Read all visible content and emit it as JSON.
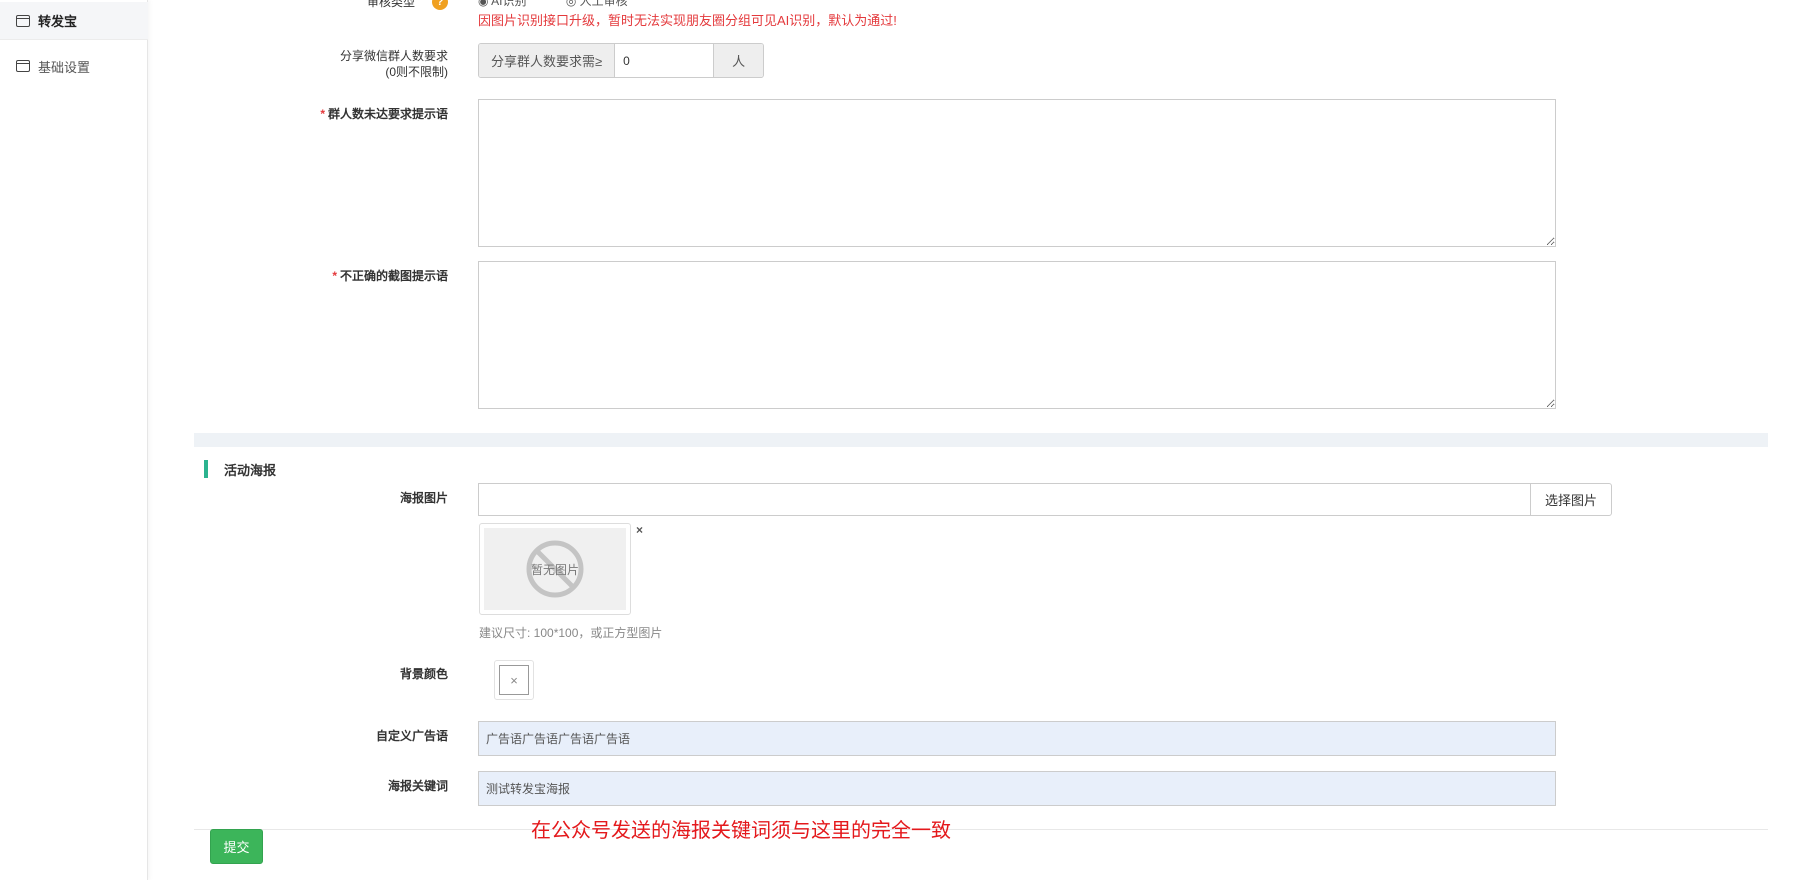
{
  "sidebar": {
    "items": [
      {
        "label": "转发宝",
        "icon": "window-icon"
      },
      {
        "label": "基础设置",
        "icon": "window-icon"
      }
    ]
  },
  "form": {
    "review_type": {
      "label": "审核类型",
      "help": "?",
      "options_text": "◉ AI识别　　　 ◎ 人工审核",
      "warning": "因图片识别接口升级，暂时无法实现朋友圈分组可见AI识别，默认为通过!"
    },
    "group_size": {
      "label_line1": "分享微信群人数要求",
      "label_line2": "(0则不限制)",
      "prefix": "分享群人数要求需≥",
      "value": "0",
      "suffix": "人"
    },
    "group_tip": {
      "required": "*",
      "label": "群人数未达要求提示语",
      "value": ""
    },
    "screenshot_tip": {
      "required": "*",
      "label": "不正确的截图提示语",
      "value": ""
    }
  },
  "poster": {
    "section_title": "活动海报",
    "image_label": "海报图片",
    "image_value": "",
    "pick_button": "选择图片",
    "no_image_text": "暂无图片",
    "remove_glyph": "×",
    "hint": "建议尺寸: 100*100，或正方型图片",
    "bg_color_label": "背景颜色",
    "bg_color_glyph": "×",
    "ad_label": "自定义广告语",
    "ad_value": "广告语广告语广告语广告语",
    "keyword_label": "海报关键词",
    "keyword_value": "测试转发宝海报"
  },
  "annotation": "在公众号发送的海报关键词须与这里的完全一致",
  "submit_label": "提交",
  "colors": {
    "accent_green": "#3cb55a",
    "section_bar": "#2bb38f",
    "warning_red": "#e4393c",
    "help_orange": "#f0a020",
    "input_fill": "#e8effa"
  }
}
